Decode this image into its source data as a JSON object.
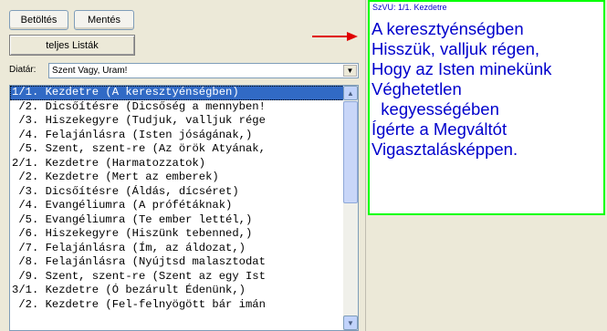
{
  "toolbar": {
    "load_label": "Betöltés",
    "save_label": "Mentés",
    "lists_label": "teljes Listák"
  },
  "diatar": {
    "label": "Diatár:",
    "selected": "Szent Vagy, Uram!"
  },
  "list": {
    "items": [
      "1/1. Kezdetre (A keresztyénségben)",
      " /2. Dicsőítésre (Dicsőség a mennyben!",
      " /3. Hiszekegyre (Tudjuk, valljuk rége",
      " /4. Felajánlásra (Isten jóságának,)",
      " /5. Szent, szent-re (Az örök Atyának,",
      "2/1. Kezdetre (Harmatozzatok)",
      " /2. Kezdetre (Mert az emberek)",
      " /3. Dicsőítésre (Áldás, dícséret)",
      " /4. Evangéliumra (A prófétáknak)",
      " /5. Evangéliumra (Te ember lettél,)",
      " /6. Hiszekegyre (Hiszünk tebenned,)",
      " /7. Felajánlásra (Ím, az áldozat,)",
      " /8. Felajánlásra (Nyújtsd malasztodat",
      " /9. Szent, szent-re (Szent az egy Ist",
      "3/1. Kezdetre (Ó bezárult Édenünk,)",
      " /2. Kezdetre (Fel-felnyögött bár imán"
    ],
    "selected_index": 0
  },
  "preview": {
    "header": "SzVU: 1/1. Kezdetre",
    "lines": [
      "A keresztyénségben",
      "Hisszük, valljuk régen,",
      "Hogy az Isten minekünk",
      "Véghetetlen",
      "  kegyességében",
      "Ígérte a Megváltót",
      "Vigasztalásképpen."
    ]
  },
  "colors": {
    "preview_text": "#0000cc",
    "preview_border": "#00ff00",
    "selection": "#316ac5",
    "arrow": "#e00000"
  }
}
